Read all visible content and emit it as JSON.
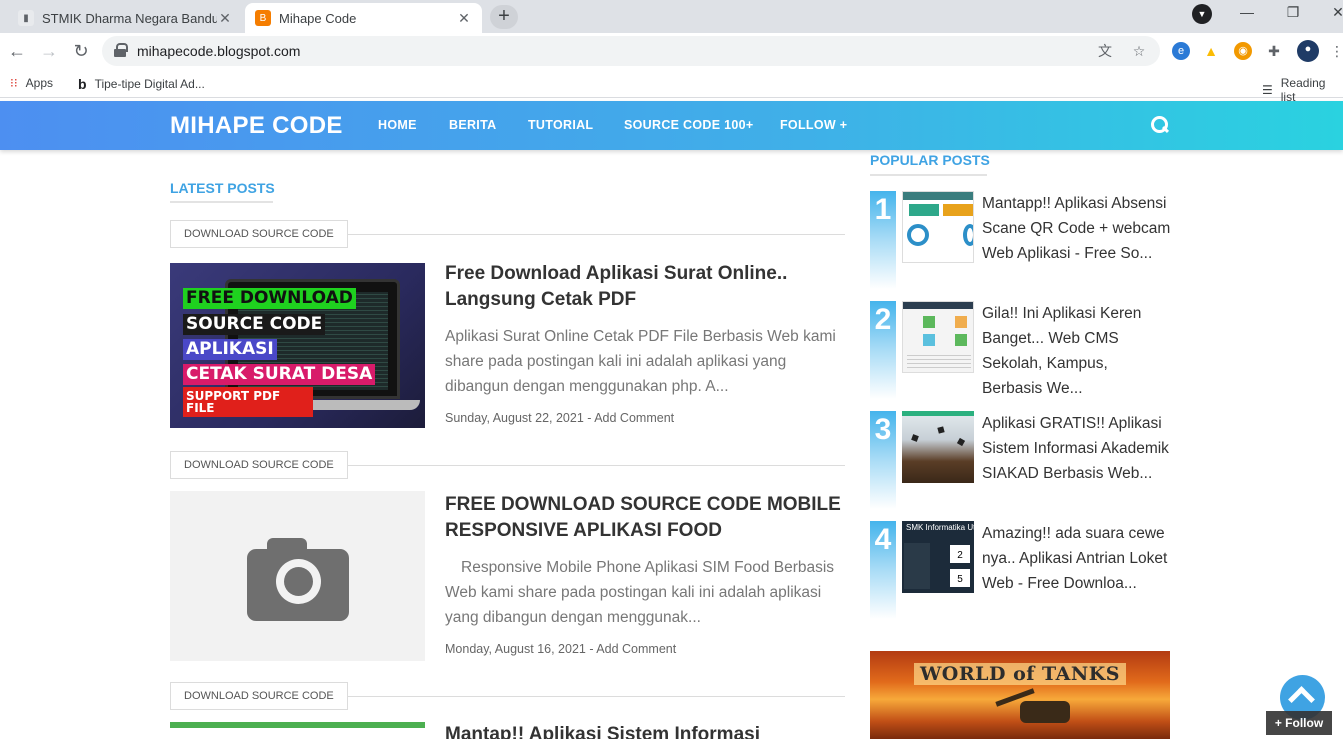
{
  "browser": {
    "tabs": [
      {
        "title": "STMIK Dharma Negara Bandung",
        "favicon": "page-icon"
      },
      {
        "title": "Mihape Code",
        "favicon": "blogger-icon"
      }
    ],
    "new_tab": "+",
    "url": "mihapecode.blogspot.com",
    "bookmarks": [
      {
        "label": "Apps",
        "icon": "apps-grid-icon"
      },
      {
        "label": "Tipe-tipe Digital Ad...",
        "icon": "bookmark-b-icon"
      }
    ],
    "reading_list": "Reading list"
  },
  "site": {
    "logo": "MIHAPE CODE",
    "menu": [
      "HOME",
      "BERITA",
      "TUTORIAL",
      "SOURCE CODE 100+",
      "FOLLOW +"
    ],
    "accent": "#3fa3e3"
  },
  "main": {
    "section_title": "LATEST POSTS",
    "posts": [
      {
        "label": "DOWNLOAD SOURCE CODE",
        "title": "Free Download Aplikasi Surat Online.. Langsung Cetak PDF",
        "snippet": "Aplikasi Surat Online Cetak PDF File Berbasis Web kami share pada postingan kali ini adalah aplikasi yang dibangun dengan menggunakan php. A...",
        "date": "Sunday, August 22, 2021",
        "comment": "Add Comment",
        "thumb_text": [
          "FREE DOWNLOAD",
          "SOURCE CODE",
          "APLIKASI",
          "CETAK SURAT DESA",
          "SUPPORT PDF FILE"
        ]
      },
      {
        "label": "DOWNLOAD SOURCE CODE",
        "title": "FREE DOWNLOAD SOURCE CODE MOBILE RESPONSIVE APLIKASI FOOD",
        "snippet": "Responsive Mobile Phone Aplikasi SIM Food Berbasis Web kami share pada postingan kali ini adalah aplikasi yang dibangun dengan menggunak...",
        "date": "Monday, August 16, 2021",
        "comment": "Add Comment"
      },
      {
        "label": "DOWNLOAD SOURCE CODE",
        "title": "Mantap!! Aplikasi Sistem Informasi"
      }
    ]
  },
  "sidebar": {
    "section_title": "POPULAR POSTS",
    "popular": [
      {
        "rank": "1",
        "title": "Mantapp!! Aplikasi Absensi Scane QR Code + webcam Web Aplikasi - Free So..."
      },
      {
        "rank": "2",
        "title": "Gila!! Ini Aplikasi Keren Banget... Web CMS Sekolah, Kampus, Berbasis We..."
      },
      {
        "rank": "3",
        "title": "Aplikasi GRATIS!! Aplikasi Sistem Informasi Akademik SIAKAD Berbasis Web..."
      },
      {
        "rank": "4",
        "title": "Amazing!! ada suara cewe nya.. Aplikasi Antrian Loket Web - Free Downloa..."
      }
    ],
    "ad_title": "WORLD of TANKS"
  },
  "floating": {
    "follow": "+ Follow"
  }
}
